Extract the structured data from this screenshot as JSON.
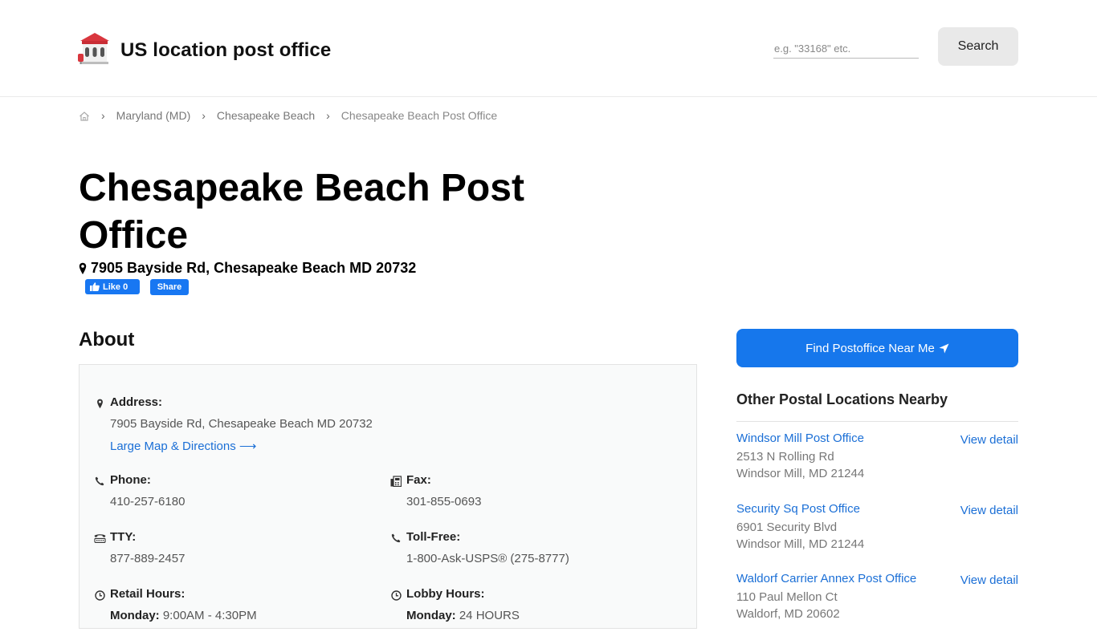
{
  "header": {
    "site_title": "US location post office",
    "search_placeholder": "e.g. \"33168\" etc.",
    "search_button": "Search"
  },
  "breadcrumb": {
    "items": [
      "Maryland (MD)",
      "Chesapeake Beach"
    ],
    "current": "Chesapeake Beach Post Office"
  },
  "page": {
    "title": "Chesapeake Beach Post Office",
    "address": "7905 Bayside Rd, Chesapeake Beach MD 20732",
    "fb_like": "Like 0",
    "fb_share": "Share"
  },
  "about": {
    "heading": "About",
    "address_label": "Address:",
    "address_value": "7905 Bayside Rd, Chesapeake Beach MD 20732",
    "map_link": "Large Map & Directions ⟶",
    "phone_label": "Phone:",
    "phone_value": "410-257-6180",
    "fax_label": "Fax:",
    "fax_value": "301-855-0693",
    "tty_label": "TTY:",
    "tty_value": "877-889-2457",
    "tollfree_label": "Toll-Free:",
    "tollfree_value": "1-800-Ask-USPS® (275-8777)",
    "retail_label": "Retail Hours:",
    "retail_day": "Monday:",
    "retail_time": "9:00AM - 4:30PM",
    "lobby_label": "Lobby Hours:",
    "lobby_day": "Monday:",
    "lobby_time": "24 HOURS"
  },
  "sidebar": {
    "find_button": "Find Postoffice Near Me",
    "nearby_heading": "Other Postal Locations Nearby",
    "detail_label": "View detail",
    "items": [
      {
        "name": "Windsor Mill Post Office",
        "street": "2513 N Rolling Rd",
        "city": "Windsor Mill, MD 21244"
      },
      {
        "name": "Security Sq Post Office",
        "street": "6901 Security Blvd",
        "city": "Windsor Mill, MD 21244"
      },
      {
        "name": "Waldorf Carrier Annex Post Office",
        "street": "110 Paul Mellon Ct",
        "city": "Waldorf, MD 20602"
      }
    ]
  },
  "colors": {
    "link": "#1b6fd6",
    "primary_button": "#1677ec",
    "facebook": "#1877f2",
    "logo_roof": "#d9363e"
  }
}
